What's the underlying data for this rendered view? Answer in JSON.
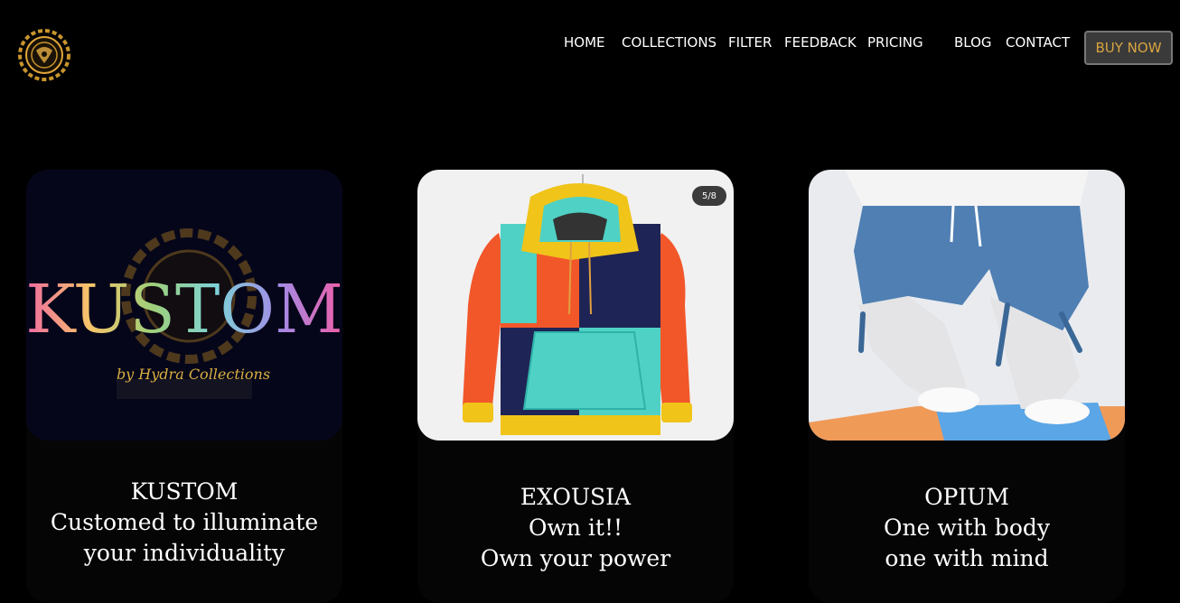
{
  "header": {
    "nav": [
      "HOME",
      "COLLECTIONS",
      "FILTER",
      "FEEDBACK",
      "PRICING",
      "BLOG",
      "CONTACT"
    ],
    "buy_label": "BUY NOW"
  },
  "cards": [
    {
      "image_title": "KUSTOM",
      "image_subtitle": "by Hydra Collections",
      "title": "KUSTOM",
      "desc1": "Customed to illuminate your individuality",
      "desc2": ""
    },
    {
      "badge": "5/8",
      "title": "EXOUSIA",
      "desc1": "Own it!!",
      "desc2": "Own your power"
    },
    {
      "title": "OPIUM",
      "desc1": "One with body",
      "desc2": "one with mind"
    }
  ],
  "colors": {
    "accent": "#d9a441",
    "background": "#000000",
    "button_bg": "#3a3a3a"
  }
}
